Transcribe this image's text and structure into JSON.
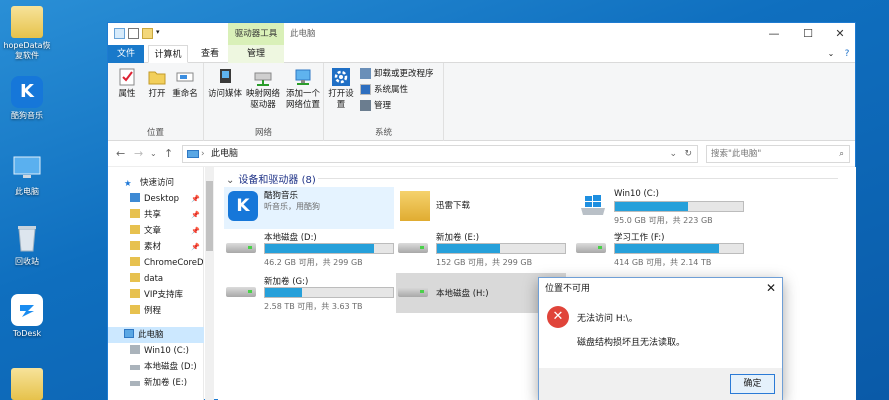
{
  "desktop": {
    "icons": [
      {
        "label": "hopeData恢复软件"
      },
      {
        "label": "酷狗音乐"
      },
      {
        "label": "此电脑"
      },
      {
        "label": "回收站"
      },
      {
        "label": "ToDesk"
      }
    ]
  },
  "window": {
    "title": "此电脑",
    "context_group": "驱动器工具",
    "controls": {
      "minimize": "—",
      "maximize": "☐",
      "close": "✕"
    },
    "tabs": [
      "文件",
      "计算机",
      "查看",
      "管理"
    ],
    "ribbon": {
      "location_group": {
        "name": "位置",
        "buttons": [
          "属性",
          "打开",
          "重命名"
        ]
      },
      "network_group": {
        "name": "网络",
        "buttons": [
          "访问媒体",
          "映射网络驱动器",
          "添加一个网络位置"
        ]
      },
      "system_group": {
        "name": "系统",
        "open_settings": "打开设置",
        "items": [
          "卸载或更改程序",
          "系统属性",
          "管理"
        ]
      }
    },
    "address": {
      "path": "此电脑",
      "search_placeholder": "搜索\"此电脑\""
    },
    "nav": {
      "quick_access": "快速访问",
      "pinned": [
        "Desktop",
        "共享",
        "文章",
        "素材"
      ],
      "folders": [
        "ChromeCoreDo",
        "data",
        "VIP支持库",
        "例程"
      ],
      "this_pc": "此电脑",
      "drives": [
        "Win10 (C:)",
        "本地磁盘 (D:)",
        "新加卷 (E:)"
      ]
    },
    "section_title": "设备和驱动器 (8)",
    "items": [
      {
        "name": "酷狗音乐",
        "sub": "听音乐，用酷狗"
      },
      {
        "name": "迅雷下载"
      },
      {
        "name": "Win10 (C:)",
        "free": "95.0 GB 可用，共 223 GB",
        "used": 0.57
      },
      {
        "name": "本地磁盘 (D:)",
        "free": "46.2 GB 可用，共 299 GB",
        "used": 0.85
      },
      {
        "name": "新加卷 (E:)",
        "free": "152 GB 可用，共 299 GB",
        "used": 0.49
      },
      {
        "name": "学习工作 (F:)",
        "free": "414 GB 可用，共 2.14 TB",
        "used": 0.81
      },
      {
        "name": "新加卷 (G:)",
        "free": "2.58 TB 可用，共 3.63 TB",
        "used": 0.29
      },
      {
        "name": "本地磁盘 (H:)"
      }
    ]
  },
  "dialog": {
    "title": "位置不可用",
    "close": "✕",
    "message1": "无法访问 H:\\。",
    "message2": "磁盘结构损坏且无法读取。",
    "ok": "确定"
  }
}
